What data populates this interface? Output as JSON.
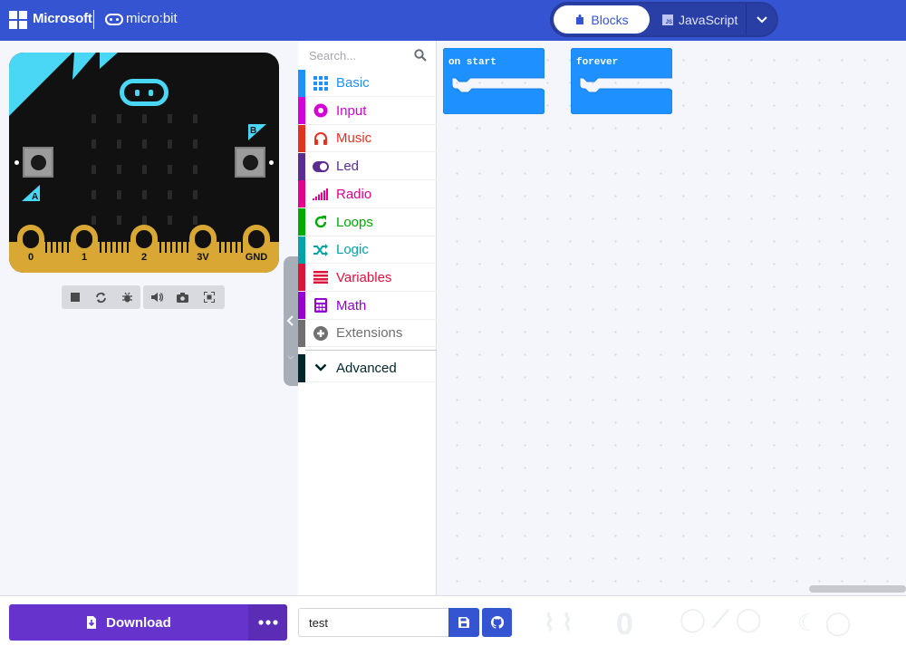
{
  "header": {
    "brand": "Microsoft",
    "product": "micro:bit",
    "mode_blocks_label": "Blocks",
    "mode_js_label": "JavaScript",
    "js_badge": "JS",
    "accent_color": "#3454d1"
  },
  "simulator": {
    "button_a_label": "A",
    "button_b_label": "B",
    "pins": [
      "0",
      "1",
      "2",
      "3V",
      "GND"
    ],
    "toolbar_icons": [
      "stop-icon",
      "restart-icon",
      "debug-icon",
      "mute-icon",
      "screenshot-icon",
      "fullscreen-icon"
    ]
  },
  "toolbox": {
    "search_placeholder": "Search...",
    "categories": [
      {
        "label": "Basic",
        "color": "#1e90ff",
        "icon": "grid-icon"
      },
      {
        "label": "Input",
        "color": "#d400d4",
        "icon": "input-icon"
      },
      {
        "label": "Music",
        "color": "#e63022",
        "icon": "headphones-icon"
      },
      {
        "label": "Led",
        "color": "#5c2d91",
        "icon": "toggle-icon"
      },
      {
        "label": "Radio",
        "color": "#e3008c",
        "icon": "signal-bars-icon"
      },
      {
        "label": "Loops",
        "color": "#00aa00",
        "icon": "loop-icon"
      },
      {
        "label": "Logic",
        "color": "#00a4a6",
        "icon": "shuffle-icon"
      },
      {
        "label": "Variables",
        "color": "#dc143c",
        "icon": "list-icon"
      },
      {
        "label": "Math",
        "color": "#9400d3",
        "icon": "calculator-icon"
      },
      {
        "label": "Extensions",
        "color": "#707070",
        "icon": "plus-circle-icon"
      }
    ],
    "advanced_label": "Advanced",
    "advanced_color": "#00272b"
  },
  "workspace": {
    "blocks": [
      {
        "label": "on start",
        "color": "#1e90ff"
      },
      {
        "label": "forever",
        "color": "#1e90ff"
      }
    ]
  },
  "bottom": {
    "download_label": "Download",
    "project_name": "test"
  }
}
